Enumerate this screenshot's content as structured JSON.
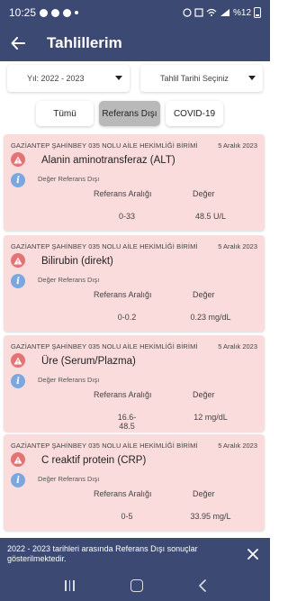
{
  "status_bar": {
    "time": "10:25",
    "battery_text": "%12"
  },
  "app_bar": {
    "title": "Tahlillerim"
  },
  "filters": {
    "year_label": "Yıl: 2022 - 2023",
    "date_label": "Tahlil Tarihi Seçiniz"
  },
  "tabs": [
    {
      "label": "Tümü",
      "selected": false
    },
    {
      "label": "Referans Dışı",
      "selected": true
    },
    {
      "label": "COVID-19",
      "selected": false
    }
  ],
  "results": [
    {
      "clinic": "GAZİANTEP ŞAHİNBEY 035 NOLU AİLE HEKİMLİĞİ BİRİMİ",
      "date": "5 Aralık 2023",
      "name": "Alanin aminotransferaz (ALT)",
      "status": "Değer Referans Dışı",
      "ref_header": "Referans Aralığı",
      "val_header": "Değer",
      "range": "0-33",
      "value": "48.5 U/L"
    },
    {
      "clinic": "GAZİANTEP ŞAHİNBEY 035 NOLU AİLE HEKİMLİĞİ BİRİMİ",
      "date": "5 Aralık 2023",
      "name": "Bilirubin (direkt)",
      "status": "Değer Referans Dışı",
      "ref_header": "Referans Aralığı",
      "val_header": "Değer",
      "range": "0-0.2",
      "value": "0.23 mg/dL"
    },
    {
      "clinic": "GAZİANTEP ŞAHİNBEY 035 NOLU AİLE HEKİMLİĞİ BİRİMİ",
      "date": "5 Aralık 2023",
      "name": "Üre (Serum/Plazma)",
      "status": "Değer Referans Dışı",
      "ref_header": "Referans Aralığı",
      "val_header": "Değer",
      "range": "16.6-48.5",
      "value": "12 mg/dL"
    },
    {
      "clinic": "GAZİANTEP ŞAHİNBEY 035 NOLU AİLE HEKİMLİĞİ BİRİMİ",
      "date": "5 Aralık 2023",
      "name": "C reaktif protein (CRP)",
      "status": "Değer Referans Dışı",
      "ref_header": "Referans Aralığı",
      "val_header": "Değer",
      "range": "0-5",
      "value": "33.95 mg/L"
    }
  ],
  "snackbar": {
    "message": "2022 - 2023 tarihleri arasında Referans Dışı sonuçlar gösterilmektedir."
  },
  "colors": {
    "primary": "#3c4a73",
    "card_bg": "#fbdcdc",
    "warn": "#e57373",
    "info": "#7ba7e0"
  }
}
